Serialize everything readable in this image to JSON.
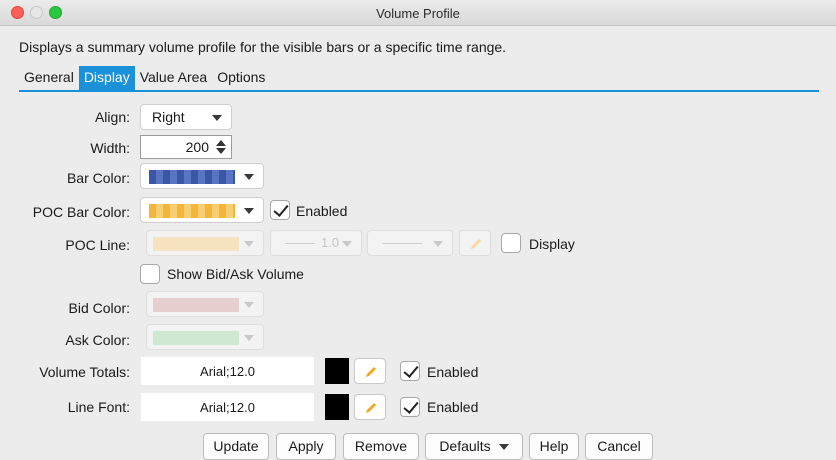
{
  "window": {
    "title": "Volume Profile"
  },
  "description": "Displays a summary volume profile for the visible bars or a specific time range.",
  "tabs": [
    {
      "label": "General",
      "active": false
    },
    {
      "label": "Display",
      "active": true
    },
    {
      "label": "Value Area",
      "active": false
    },
    {
      "label": "Options",
      "active": false
    }
  ],
  "form": {
    "align": {
      "label": "Align:",
      "value": "Right"
    },
    "width": {
      "label": "Width:",
      "value": "200"
    },
    "bar_color": {
      "label": "Bar Color:",
      "color": "#3a57a6"
    },
    "poc_bar_color": {
      "label": "POC Bar Color:",
      "color": "#f4b63a",
      "enabled_label": "Enabled",
      "enabled": true
    },
    "poc_line": {
      "label": "POC Line:",
      "color": "#f7e3c2",
      "width_value": "1.0",
      "display_label": "Display",
      "display": false
    },
    "show_bid_ask": {
      "label": "Show Bid/Ask Volume",
      "checked": false
    },
    "bid_color": {
      "label": "Bid Color:",
      "color": "#e8cfcf"
    },
    "ask_color": {
      "label": "Ask Color:",
      "color": "#cfe8d2"
    },
    "volume_totals": {
      "label": "Volume Totals:",
      "font": "Arial;12.0",
      "color": "#000000",
      "enabled_label": "Enabled",
      "enabled": true
    },
    "line_font": {
      "label": "Line Font:",
      "font": "Arial;12.0",
      "color": "#000000",
      "enabled_label": "Enabled",
      "enabled": true
    }
  },
  "buttons": {
    "update": "Update",
    "apply": "Apply",
    "remove": "Remove",
    "defaults": "Defaults",
    "help": "Help",
    "cancel": "Cancel"
  },
  "icons": {
    "pencil": "pencil-icon",
    "dropdown": "chevron-down-icon",
    "check": "check-icon"
  },
  "colors": {
    "accent": "#1a91d9",
    "pencil": "#f5a623"
  }
}
